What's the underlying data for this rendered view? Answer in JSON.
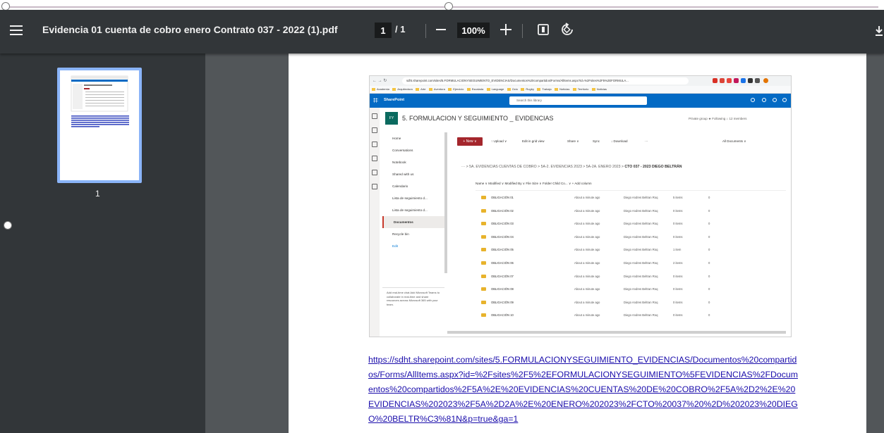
{
  "toolbar": {
    "title": "Evidencia 01 cuenta de cobro enero Contrato 037 - 2022 (1).pdf",
    "current_page": "1",
    "page_separator": "/  1",
    "zoom": "100%",
    "icons": [
      "menu-icon",
      "zoom-out-icon",
      "zoom-in-icon",
      "fit-to-page-icon",
      "rotate-icon",
      "download-icon"
    ]
  },
  "thumbnails": [
    {
      "page_number": "1",
      "selected": true
    }
  ],
  "screenshot": {
    "url": "sdht.sharepoint.com/sites/5.FORMULACIONYSEGUIMIENTO_EVIDENCIAS/Documentos%20compartidos/Forms/AllItems.aspx?id=%2Fsites%2F5%2EFORMULA...",
    "bookmarks": [
      "Academia",
      "Arquitectura",
      "Arte",
      "Aventura",
      "Ejercicio",
      "Escalada",
      "Language",
      "Ocio",
      "Rugby",
      "Trabajo",
      "Noticias",
      "Territorio",
      "Noticias"
    ],
    "app_name": "SharePoint",
    "search_placeholder": "Search this library",
    "site_initials": "FY",
    "site_name": "5. FORMULACION Y SEGUIMIENTO _ EVIDENCIAS",
    "site_meta": "Private group  ★ Following   ⌂ 12 members",
    "nav": [
      "Home",
      "Conversations",
      "Notebook",
      "Shared with us",
      "Calendario",
      "Lista de seguimiento d...",
      "Lista de seguimiento d...",
      "Documentos",
      "Recycle bin",
      "Edit"
    ],
    "chat_card": "Add real-time chat  Add Microsoft Teams to collaborate in real-time and share resources across Microsoft 365 with your team.",
    "commands": {
      "new": "+ New ∨",
      "upload": "↑ Upload ∨",
      "grid": "Edit in grid view",
      "share": "Share ∨",
      "sync": "Sync",
      "download": "↓ Download",
      "more": "···",
      "view": "All Documents ∨"
    },
    "breadcrumb": "··· > 5A. EVIDENCIAS CUENTAS DE COBRO > 5A-2. EVIDENCIAS 2023 > 5A-2A. ENERO 2023 >",
    "breadcrumb_current": "CTO 037 - 2023 DIEGO BELTRÁN",
    "columns": [
      "Name ∨",
      "Modified ∨",
      "Modified By ∨",
      "File Size ∨",
      "Folder Child Co... ∨",
      "+ Add column"
    ],
    "rows": [
      {
        "name": "OBLIGACIÓN 01",
        "modified": "About a minute ago",
        "by": "Diego Andres Beltran Roq",
        "size": "5 items",
        "children": "0"
      },
      {
        "name": "OBLIGACIÓN 02",
        "modified": "About a minute ago",
        "by": "Diego Andres Beltran Roq",
        "size": "0 items",
        "children": "0"
      },
      {
        "name": "OBLIGACIÓN 03",
        "modified": "About a minute ago",
        "by": "Diego Andres Beltran Roq",
        "size": "0 items",
        "children": "0"
      },
      {
        "name": "OBLIGACIÓN 04",
        "modified": "About a minute ago",
        "by": "Diego Andres Beltran Roq",
        "size": "0 items",
        "children": "0"
      },
      {
        "name": "OBLIGACIÓN 05",
        "modified": "About a minute ago",
        "by": "Diego Andres Beltran Roq",
        "size": "1 item",
        "children": "0"
      },
      {
        "name": "OBLIGACIÓN 06",
        "modified": "About a minute ago",
        "by": "Diego Andres Beltran Roq",
        "size": "2 items",
        "children": "0"
      },
      {
        "name": "OBLIGACIÓN 07",
        "modified": "About a minute ago",
        "by": "Diego Andres Beltran Roq",
        "size": "0 items",
        "children": "0"
      },
      {
        "name": "OBLIGACIÓN 08",
        "modified": "About a minute ago",
        "by": "Diego Andres Beltran Roq",
        "size": "0 items",
        "children": "0"
      },
      {
        "name": "OBLIGACIÓN 09",
        "modified": "About a minute ago",
        "by": "Diego Andres Beltran Roq",
        "size": "0 items",
        "children": "0"
      },
      {
        "name": "OBLIGACIÓN 10",
        "modified": "About a minute ago",
        "by": "Diego Andres Beltran Roq",
        "size": "0 items",
        "children": "0"
      }
    ]
  },
  "link_text": "https://sdht.sharepoint.com/sites/5.FORMULACIONYSEGUIMIENTO_EVIDENCIAS/Documentos%20compartidos/Forms/AllItems.aspx?id=%2Fsites%2F5%2EFORMULACIONYSEGUIMIENTO%5FEVIDENCIAS%2FDocumentos%20compartidos%2F5A%2E%20EVIDENCIAS%20CUENTAS%20DE%20COBRO%2F5A%2D2%2E%20EVIDENCIAS%202023%2F5A%2D2A%2E%20ENERO%202023%2FCTO%20037%20%2D%202023%20DIEGO%20BELTR%C3%81N&p=true&ga=1",
  "colors": {
    "toolbar": "#323639",
    "viewer_bg": "#525659",
    "thumb_border": "#8ab4f8",
    "link": "#1a0dab",
    "sharepoint_blue": "#036ac4",
    "new_button": "#a4262c"
  }
}
